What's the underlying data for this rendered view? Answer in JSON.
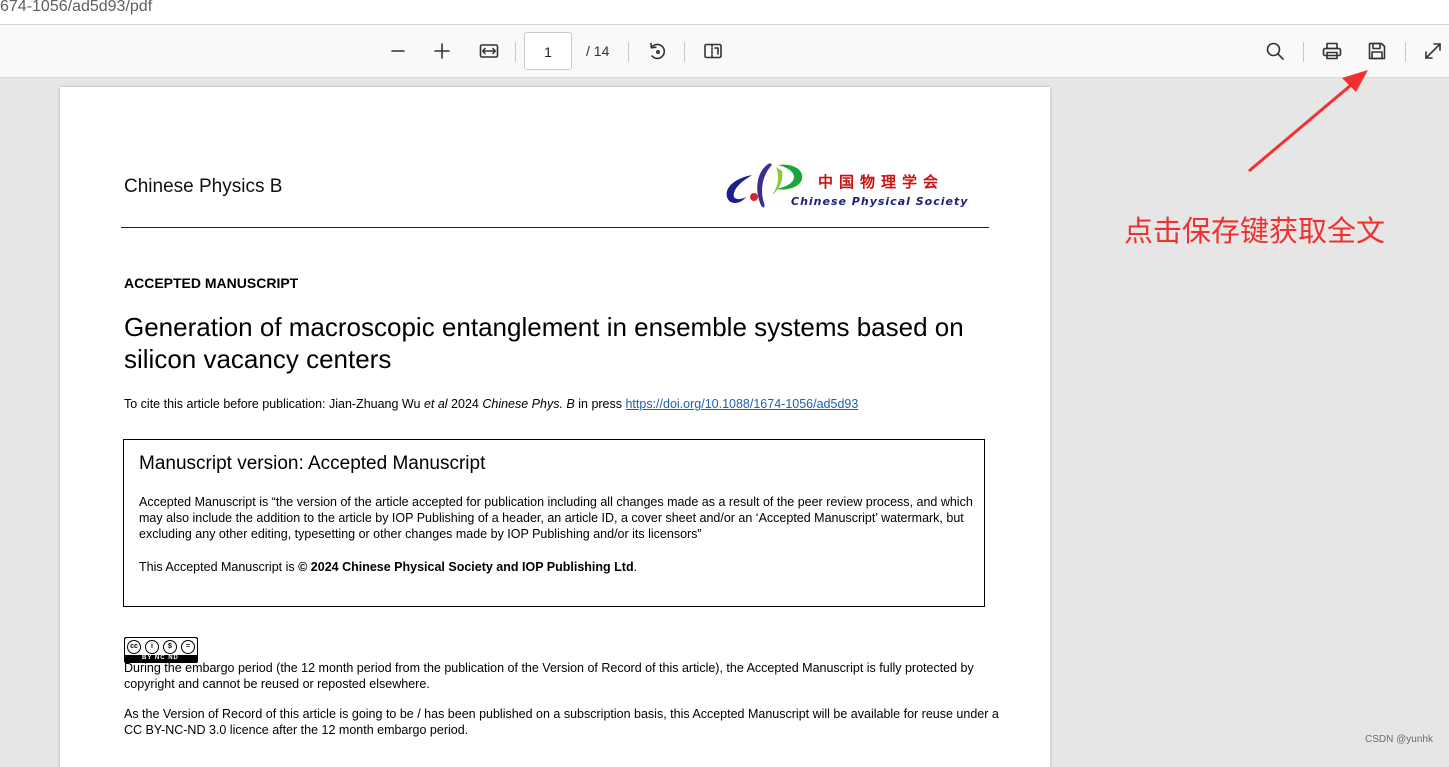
{
  "address_bar": {
    "url_fragment": "674-1056/ad5d93/pdf"
  },
  "toolbar": {
    "zoom_out_icon": "minus-icon",
    "zoom_in_icon": "plus-icon",
    "fit_width_icon": "fit-width-icon",
    "current_page": "1",
    "total_pages": "/ 14",
    "rotate_icon": "rotate-icon",
    "two_page_icon": "two-page-view-icon",
    "search_icon": "search-icon",
    "print_icon": "print-icon",
    "save_icon": "save-icon",
    "expand_icon": "expand-icon"
  },
  "document": {
    "journal_name": "Chinese Physics B",
    "logo_cn": "中国物理学会",
    "logo_en": "Chinese Physical Society",
    "status_label": "ACCEPTED MANUSCRIPT",
    "title": "Generation of macroscopic entanglement in ensemble systems based on silicon vacancy centers",
    "cite_prefix": "To cite this article before publication: Jian-Zhuang Wu ",
    "cite_etal": "et al",
    "cite_year": " 2024 ",
    "cite_journal": "Chinese Phys. B",
    "cite_inpress": " in press ",
    "cite_doi": "https://doi.org/10.1088/1674-1056/ad5d93",
    "box_title": "Manuscript version: Accepted Manuscript",
    "box_paragraph": "Accepted Manuscript is “the version of the article accepted for publication including all changes made as a result of the peer review process, and which may also include the addition to the article by IOP Publishing of a header, an article ID, a cover sheet and/or an ‘Accepted Manuscript’ watermark, but excluding any other editing, typesetting or other changes made by IOP Publishing and/or its licensors”",
    "box_copyright_prefix": "This Accepted Manuscript is ",
    "box_copyright_bold": "© 2024 Chinese Physical Society and IOP Publishing Ltd",
    "box_copyright_suffix": ".",
    "cc_badge_text": "BY  NC  ND",
    "embargo_paragraph": "During the embargo period (the 12 month period from the publication of the Version of Record of this article), the Accepted Manuscript is fully protected by copyright and cannot be reused or reposted elsewhere.",
    "license_paragraph": "As the Version of Record of this article is going to be / has been published on a subscription basis, this Accepted Manuscript will be available for reuse under a CC BY-NC-ND 3.0 licence after the 12 month embargo period."
  },
  "annotation": {
    "text": "点击保存键获取全文",
    "color": "#f0312f"
  },
  "watermark": "CSDN @yunhk"
}
